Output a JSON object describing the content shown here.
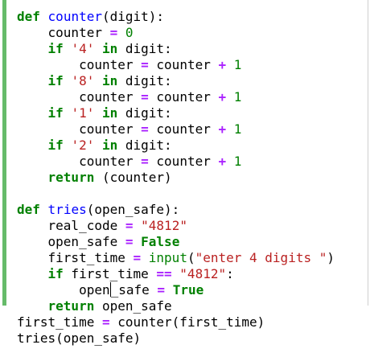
{
  "accent": "#66bb6a",
  "lines": [
    [
      {
        "t": "def",
        "k": "kw"
      },
      {
        "t": " ",
        "k": "ws"
      },
      {
        "t": "counter",
        "k": "fn"
      },
      {
        "t": "(digit):",
        "k": "punc"
      }
    ],
    [
      {
        "t": "    ",
        "k": "ws"
      },
      {
        "t": "counter",
        "k": "name"
      },
      {
        "t": " ",
        "k": "ws"
      },
      {
        "t": "=",
        "k": "op"
      },
      {
        "t": " ",
        "k": "ws"
      },
      {
        "t": "0",
        "k": "num"
      }
    ],
    [
      {
        "t": "    ",
        "k": "ws"
      },
      {
        "t": "if",
        "k": "kw"
      },
      {
        "t": " ",
        "k": "ws"
      },
      {
        "t": "'4'",
        "k": "str"
      },
      {
        "t": " ",
        "k": "ws"
      },
      {
        "t": "in",
        "k": "kw"
      },
      {
        "t": " digit:",
        "k": "name"
      }
    ],
    [
      {
        "t": "        ",
        "k": "ws"
      },
      {
        "t": "counter",
        "k": "name"
      },
      {
        "t": " ",
        "k": "ws"
      },
      {
        "t": "=",
        "k": "op"
      },
      {
        "t": " counter ",
        "k": "name"
      },
      {
        "t": "+",
        "k": "op"
      },
      {
        "t": " ",
        "k": "ws"
      },
      {
        "t": "1",
        "k": "num"
      }
    ],
    [
      {
        "t": "    ",
        "k": "ws"
      },
      {
        "t": "if",
        "k": "kw"
      },
      {
        "t": " ",
        "k": "ws"
      },
      {
        "t": "'8'",
        "k": "str"
      },
      {
        "t": " ",
        "k": "ws"
      },
      {
        "t": "in",
        "k": "kw"
      },
      {
        "t": " digit:",
        "k": "name"
      }
    ],
    [
      {
        "t": "        ",
        "k": "ws"
      },
      {
        "t": "counter",
        "k": "name"
      },
      {
        "t": " ",
        "k": "ws"
      },
      {
        "t": "=",
        "k": "op"
      },
      {
        "t": " counter ",
        "k": "name"
      },
      {
        "t": "+",
        "k": "op"
      },
      {
        "t": " ",
        "k": "ws"
      },
      {
        "t": "1",
        "k": "num"
      }
    ],
    [
      {
        "t": "    ",
        "k": "ws"
      },
      {
        "t": "if",
        "k": "kw"
      },
      {
        "t": " ",
        "k": "ws"
      },
      {
        "t": "'1'",
        "k": "str"
      },
      {
        "t": " ",
        "k": "ws"
      },
      {
        "t": "in",
        "k": "kw"
      },
      {
        "t": " digit:",
        "k": "name"
      }
    ],
    [
      {
        "t": "        ",
        "k": "ws"
      },
      {
        "t": "counter",
        "k": "name"
      },
      {
        "t": " ",
        "k": "ws"
      },
      {
        "t": "=",
        "k": "op"
      },
      {
        "t": " counter ",
        "k": "name"
      },
      {
        "t": "+",
        "k": "op"
      },
      {
        "t": " ",
        "k": "ws"
      },
      {
        "t": "1",
        "k": "num"
      }
    ],
    [
      {
        "t": "    ",
        "k": "ws"
      },
      {
        "t": "if",
        "k": "kw"
      },
      {
        "t": " ",
        "k": "ws"
      },
      {
        "t": "'2'",
        "k": "str"
      },
      {
        "t": " ",
        "k": "ws"
      },
      {
        "t": "in",
        "k": "kw"
      },
      {
        "t": " digit:",
        "k": "name"
      }
    ],
    [
      {
        "t": "        ",
        "k": "ws"
      },
      {
        "t": "counter",
        "k": "name"
      },
      {
        "t": " ",
        "k": "ws"
      },
      {
        "t": "=",
        "k": "op"
      },
      {
        "t": " counter ",
        "k": "name"
      },
      {
        "t": "+",
        "k": "op"
      },
      {
        "t": " ",
        "k": "ws"
      },
      {
        "t": "1",
        "k": "num"
      }
    ],
    [
      {
        "t": "    ",
        "k": "ws"
      },
      {
        "t": "return",
        "k": "kw"
      },
      {
        "t": " (counter)",
        "k": "name"
      }
    ],
    [],
    [
      {
        "t": "def",
        "k": "kw"
      },
      {
        "t": " ",
        "k": "ws"
      },
      {
        "t": "tries",
        "k": "fn"
      },
      {
        "t": "(open_safe):",
        "k": "punc"
      }
    ],
    [
      {
        "t": "    ",
        "k": "ws"
      },
      {
        "t": "real_code",
        "k": "name"
      },
      {
        "t": " ",
        "k": "ws"
      },
      {
        "t": "=",
        "k": "op"
      },
      {
        "t": " ",
        "k": "ws"
      },
      {
        "t": "\"4812\"",
        "k": "str"
      }
    ],
    [
      {
        "t": "    ",
        "k": "ws"
      },
      {
        "t": "open_safe",
        "k": "name"
      },
      {
        "t": " ",
        "k": "ws"
      },
      {
        "t": "=",
        "k": "op"
      },
      {
        "t": " ",
        "k": "ws"
      },
      {
        "t": "False",
        "k": "bool"
      }
    ],
    [
      {
        "t": "    ",
        "k": "ws"
      },
      {
        "t": "first_time",
        "k": "name"
      },
      {
        "t": " ",
        "k": "ws"
      },
      {
        "t": "=",
        "k": "op"
      },
      {
        "t": " ",
        "k": "ws"
      },
      {
        "t": "input",
        "k": "bi"
      },
      {
        "t": "(",
        "k": "punc"
      },
      {
        "t": "\"enter 4 digits \"",
        "k": "str"
      },
      {
        "t": ")",
        "k": "punc"
      }
    ],
    [
      {
        "t": "    ",
        "k": "ws"
      },
      {
        "t": "if",
        "k": "kw"
      },
      {
        "t": " first_time ",
        "k": "name"
      },
      {
        "t": "==",
        "k": "op"
      },
      {
        "t": " ",
        "k": "ws"
      },
      {
        "t": "\"4812\"",
        "k": "str"
      },
      {
        "t": ":",
        "k": "punc"
      }
    ],
    [
      {
        "t": "        ",
        "k": "ws"
      },
      {
        "t": "open",
        "k": "name"
      },
      {
        "t": "",
        "k": "caret"
      },
      {
        "t": "_safe",
        "k": "name"
      },
      {
        "t": " ",
        "k": "ws"
      },
      {
        "t": "=",
        "k": "op"
      },
      {
        "t": " ",
        "k": "ws"
      },
      {
        "t": "True",
        "k": "bool"
      }
    ],
    [
      {
        "t": "    ",
        "k": "ws"
      },
      {
        "t": "return",
        "k": "kw"
      },
      {
        "t": " open_safe",
        "k": "name"
      }
    ],
    [
      {
        "t": "first_time",
        "k": "name"
      },
      {
        "t": " ",
        "k": "ws"
      },
      {
        "t": "=",
        "k": "op"
      },
      {
        "t": " counter(first_time)",
        "k": "name"
      }
    ],
    [
      {
        "t": "tries(open_safe)",
        "k": "name"
      }
    ]
  ]
}
